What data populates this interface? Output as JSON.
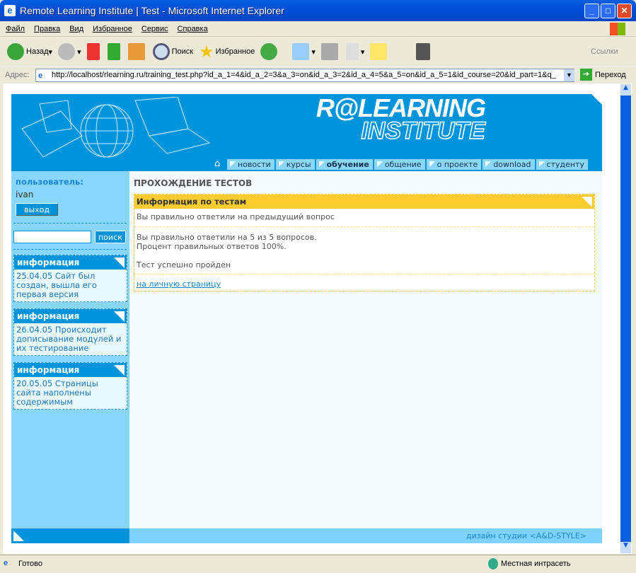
{
  "window": {
    "title": "Remote Learning Institute | Test - Microsoft Internet Explorer"
  },
  "menu": [
    "Файл",
    "Правка",
    "Вид",
    "Избранное",
    "Сервис",
    "Справка"
  ],
  "toolbar": {
    "back": "Назад",
    "search": "Поиск",
    "favorites": "Избранное",
    "links": "Ссылки"
  },
  "address": {
    "label": "Адрес:",
    "url": "http://localhost/rlearning.ru/training_test.php?id_a_1=4&id_a_2=3&a_3=on&id_a_3=2&id_a_4=5&a_5=on&id_a_5=1&id_course=20&id_part=1&q_",
    "go": "Переход"
  },
  "site": {
    "logo_line1": "R@LEARNING",
    "logo_line2": "INSTITUTE",
    "nav": [
      {
        "label": "новости"
      },
      {
        "label": "курсы"
      },
      {
        "label": "обучение",
        "active": true
      },
      {
        "label": "общение"
      },
      {
        "label": "о проекте"
      },
      {
        "label": "download"
      },
      {
        "label": "студенту"
      }
    ],
    "sidebar": {
      "user_label": "пользователь:",
      "username": "ivan",
      "logout": "выход",
      "search_placeholder": "",
      "search_button": "поиск",
      "info": [
        {
          "title": "информация",
          "text": "25.04.05 Сайт был создан, вышла его первая версия"
        },
        {
          "title": "информация",
          "text": "26.04.05 Происходит дописывание модулей и их тестирование"
        },
        {
          "title": "информация",
          "text": "20.05.05 Страницы сайта наполнены содержимым"
        }
      ]
    },
    "main": {
      "page_title": "ПРОХОЖДЕНИЕ ТЕСТОВ",
      "box_title": "Информация по тестам",
      "prev_result": "Вы правильно ответили на предыдущий вопрос",
      "score": "Вы правильно ответили на 5 из 5 вопросов.",
      "percent": "Процент правильных ответов 100%.",
      "verdict": "Тест успешно пройден",
      "link": "на личную страницу"
    },
    "footer": "дизайн студии <A&D-STYLE>"
  },
  "status": {
    "text": "Готово",
    "zone": "Местная интрасеть"
  }
}
